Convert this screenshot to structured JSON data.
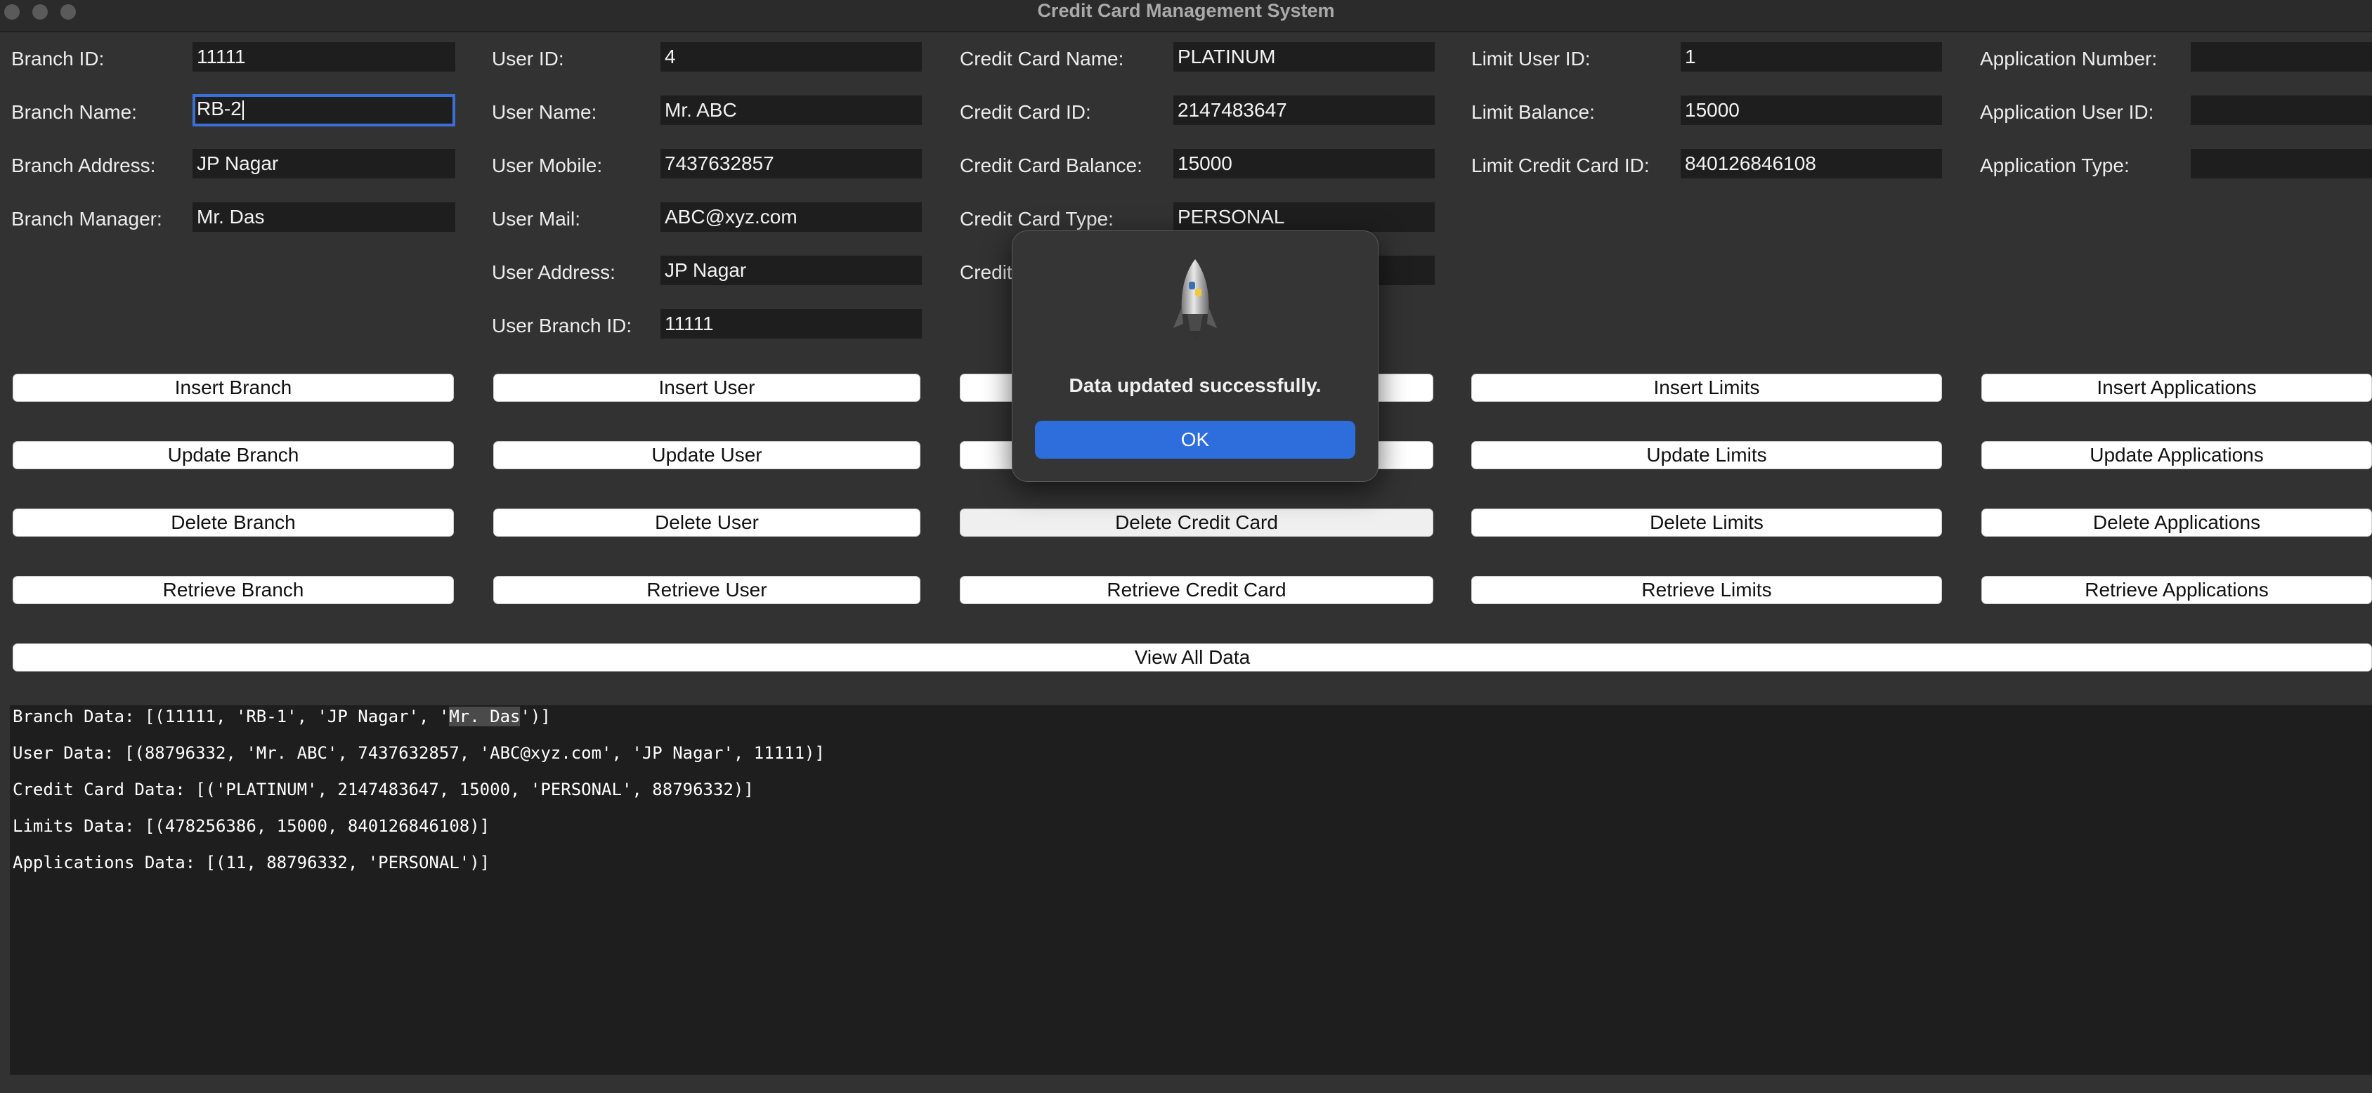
{
  "window": {
    "title": "Credit Card Management System"
  },
  "branch": {
    "labels": [
      "Branch ID:",
      "Branch Name:",
      "Branch Address:",
      "Branch Manager:"
    ],
    "values": [
      "11111",
      "RB-2",
      "JP Nagar",
      "Mr. Das"
    ],
    "buttons": [
      "Insert Branch",
      "Update Branch",
      "Delete Branch",
      "Retrieve Branch"
    ]
  },
  "user": {
    "labels": [
      "User ID:",
      "User Name:",
      "User Mobile:",
      "User Mail:",
      "User Address:",
      "User Branch ID:"
    ],
    "values": [
      "4",
      "Mr. ABC",
      "7437632857",
      "ABC@xyz.com",
      "JP Nagar",
      "11111"
    ],
    "buttons": [
      "Insert User",
      "Update User",
      "Delete User",
      "Retrieve User"
    ]
  },
  "credit_card": {
    "labels": [
      "Credit Card Name:",
      "Credit Card ID:",
      "Credit Card Balance:",
      "Credit Card Type:",
      "Credit"
    ],
    "values": [
      "PLATINUM",
      "2147483647",
      "15000",
      "PERSONAL",
      ""
    ],
    "buttons": [
      "Delete Credit Card",
      "Retrieve Credit Card"
    ]
  },
  "limits": {
    "labels": [
      "Limit User ID:",
      "Limit Balance:",
      "Limit Credit Card ID:"
    ],
    "values": [
      "1",
      "15000",
      "840126846108"
    ],
    "buttons": [
      "Insert Limits",
      "Update Limits",
      "Delete Limits",
      "Retrieve Limits"
    ]
  },
  "applications": {
    "labels": [
      "Application Number:",
      "Application User ID:",
      "Application Type:"
    ],
    "values": [
      "",
      "",
      ""
    ],
    "buttons": [
      "Insert Applications",
      "Update Applications",
      "Delete Applications",
      "Retrieve Applications"
    ]
  },
  "view_all_label": "View All Data",
  "output": {
    "line1_prefix": "Branch Data: [(11111, 'RB-1', 'JP Nagar', '",
    "line1_sel": "Mr. Das",
    "line1_suffix": "')]",
    "line2": "User Data: [(88796332, 'Mr. ABC', 7437632857, 'ABC@xyz.com', 'JP Nagar', 11111)]",
    "line3": "Credit Card Data: [('PLATINUM', 2147483647, 15000, 'PERSONAL', 88796332)]",
    "line4": "Limits Data: [(478256386, 15000, 840126846108)]",
    "line5": "Applications Data: [(11, 88796332, 'PERSONAL')]"
  },
  "dialog": {
    "message": "Data updated successfully.",
    "ok_label": "OK",
    "icon": "python-rocket-icon"
  }
}
